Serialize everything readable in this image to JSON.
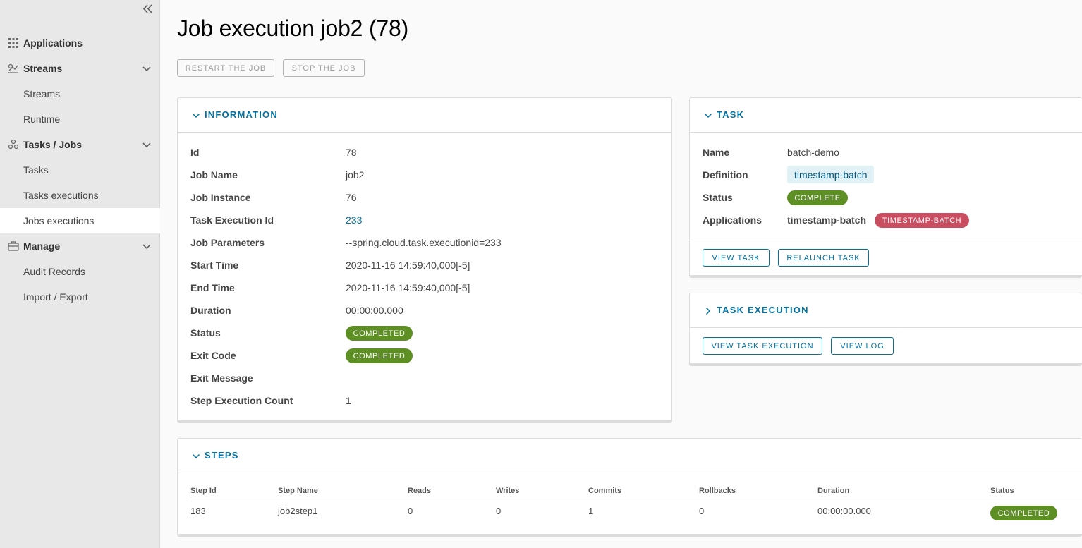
{
  "sidebar": {
    "groups": {
      "applications": "Applications",
      "streams": "Streams",
      "tasks_jobs": "Tasks / Jobs",
      "manage": "Manage"
    },
    "items": {
      "streams": "Streams",
      "runtime": "Runtime",
      "tasks": "Tasks",
      "tasks_executions": "Tasks executions",
      "jobs_executions": "Jobs executions",
      "audit_records": "Audit Records",
      "import_export": "Import / Export"
    }
  },
  "page": {
    "title": "Job execution job2 (78)",
    "restart_label": "RESTART THE JOB",
    "stop_label": "STOP THE JOB"
  },
  "information": {
    "title": "INFORMATION",
    "rows": [
      {
        "label": "Id",
        "value": "78"
      },
      {
        "label": "Job Name",
        "value": "job2"
      },
      {
        "label": "Job Instance",
        "value": "76"
      },
      {
        "label": "Task Execution Id",
        "value": "233"
      },
      {
        "label": "Job Parameters",
        "value": "--spring.cloud.task.executionid=233"
      },
      {
        "label": "Start Time",
        "value": "2020-11-16 14:59:40,000[-5]"
      },
      {
        "label": "End Time",
        "value": "2020-11-16 14:59:40,000[-5]"
      },
      {
        "label": "Duration",
        "value": "00:00:00.000"
      },
      {
        "label": "Status",
        "value": "COMPLETED"
      },
      {
        "label": "Exit Code",
        "value": "COMPLETED"
      },
      {
        "label": "Exit Message",
        "value": ""
      },
      {
        "label": "Step Execution Count",
        "value": "1"
      }
    ]
  },
  "task": {
    "title": "TASK",
    "name_label": "Name",
    "name_value": "batch-demo",
    "definition_label": "Definition",
    "definition_value": "timestamp-batch",
    "status_label": "Status",
    "status_value": "COMPLETE",
    "applications_label": "Applications",
    "applications_value": "timestamp-batch",
    "applications_badge": "TIMESTAMP-BATCH",
    "view_task_label": "VIEW TASK",
    "relaunch_task_label": "RELAUNCH TASK"
  },
  "task_execution": {
    "title": "TASK EXECUTION",
    "view_execution_label": "VIEW TASK EXECUTION",
    "view_log_label": "VIEW LOG"
  },
  "steps": {
    "title": "STEPS",
    "columns": [
      "Step Id",
      "Step Name",
      "Reads",
      "Writes",
      "Commits",
      "Rollbacks",
      "Duration",
      "Status"
    ],
    "rows": [
      {
        "step_id": "183",
        "step_name": "job2step1",
        "reads": "0",
        "writes": "0",
        "commits": "1",
        "rollbacks": "0",
        "duration": "00:00:00.000",
        "status": "COMPLETED"
      }
    ]
  },
  "colors": {
    "accent": "#0072a3",
    "success": "#5e8f24",
    "danger": "#c94e61"
  }
}
